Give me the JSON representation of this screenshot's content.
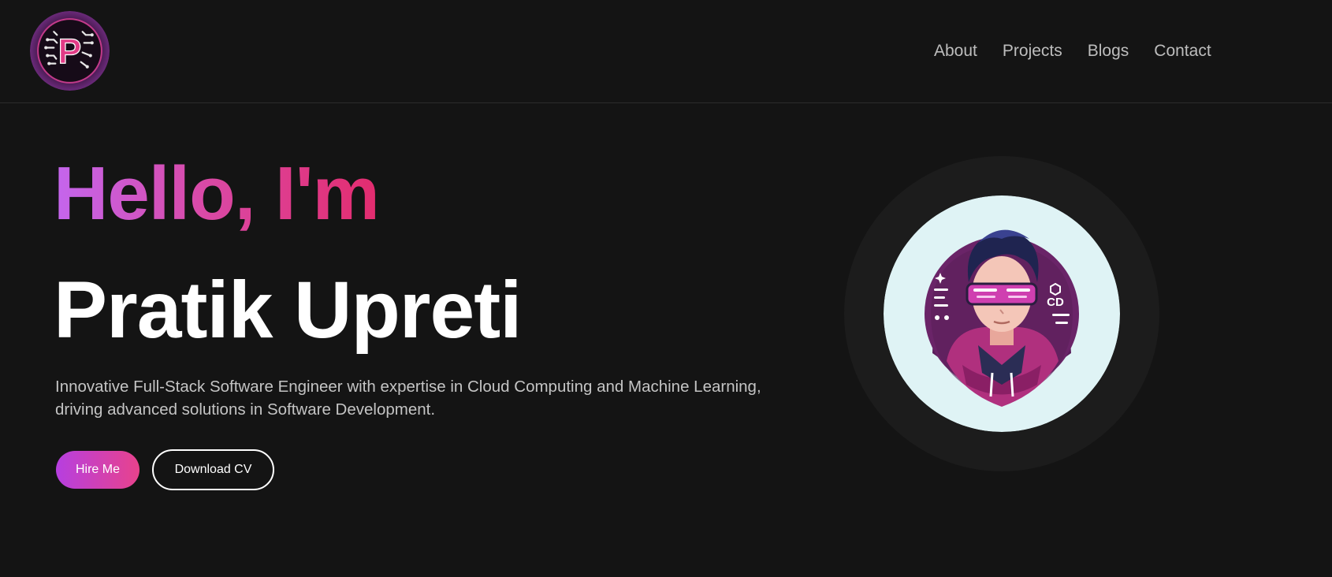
{
  "nav": {
    "logo_letter": "P",
    "links": [
      "About",
      "Projects",
      "Blogs",
      "Contact"
    ]
  },
  "hero": {
    "greeting": "Hello, I'm",
    "name": "Pratik Upreti",
    "description": "Innovative Full-Stack Software Engineer with expertise in Cloud Computing and Machine Learning, driving advanced solutions in Software Development.",
    "hire_button": "Hire Me",
    "cv_button": "Download CV",
    "avatar_badge_text": "CD"
  },
  "colors": {
    "background": "#141414",
    "accent_purple": "#c466ee",
    "accent_pink": "#e32c6e",
    "nav_text": "#bdbdbd",
    "body_text": "#c4c4c4",
    "avatar_bg": "#dff3f5"
  },
  "icons": {
    "logo": "circuit-p-logo-icon",
    "avatar": "developer-avatar-icon"
  }
}
